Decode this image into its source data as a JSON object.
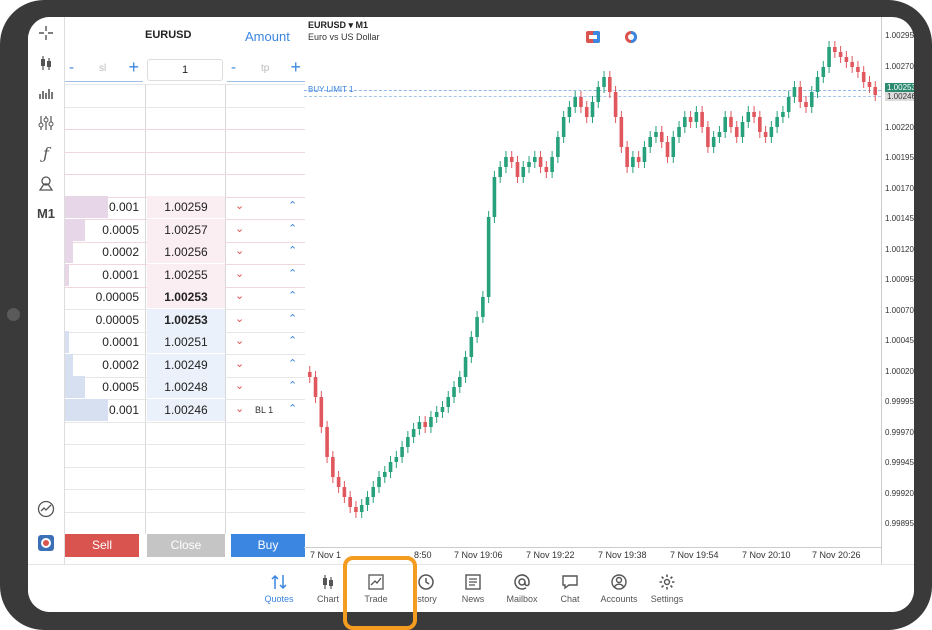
{
  "dom": {
    "symbol": "EURUSD",
    "amount_label": "Amount",
    "sl_placeholder": "sl",
    "tp_placeholder": "tp",
    "volume": "1",
    "minus": "-",
    "plus": "+",
    "rows": [
      {
        "vol": "0.001",
        "price": "1.00259",
        "side": "ask",
        "bar": 0.55,
        "best": false
      },
      {
        "vol": "0.0005",
        "price": "1.00257",
        "side": "ask",
        "bar": 0.25,
        "best": false
      },
      {
        "vol": "0.0002",
        "price": "1.00256",
        "side": "ask",
        "bar": 0.1,
        "best": false
      },
      {
        "vol": "0.0001",
        "price": "1.00255",
        "side": "ask",
        "bar": 0.05,
        "best": false
      },
      {
        "vol": "0.00005",
        "price": "1.00253",
        "side": "ask",
        "bar": 0.0,
        "best": true
      },
      {
        "vol": "0.00005",
        "price": "1.00253",
        "side": "bid",
        "bar": 0.0,
        "best": true
      },
      {
        "vol": "0.0001",
        "price": "1.00251",
        "side": "bid",
        "bar": 0.05,
        "best": false
      },
      {
        "vol": "0.0002",
        "price": "1.00249",
        "side": "bid",
        "bar": 0.1,
        "best": false
      },
      {
        "vol": "0.0005",
        "price": "1.00248",
        "side": "bid",
        "bar": 0.25,
        "best": false
      },
      {
        "vol": "0.001",
        "price": "1.00246",
        "side": "bid",
        "bar": 0.55,
        "best": false,
        "order": "BL 1"
      }
    ],
    "sell_label": "Sell",
    "close_label": "Close",
    "buy_label": "Buy"
  },
  "chart": {
    "symbol": "EURUSD",
    "timeframe": "M1",
    "description": "Euro vs US Dollar",
    "order_line_label": "BUY LIMIT 1",
    "current_price_tag": "1.00253",
    "limit_price_tag": "1.00246",
    "y_ticks": [
      "1.00295",
      "1.00270",
      "1.00245",
      "1.00220",
      "1.00195",
      "1.00170",
      "1.00145",
      "1.00120",
      "1.00095",
      "1.00070",
      "1.00045",
      "1.00020",
      "0.99995",
      "0.99970",
      "0.99945",
      "0.99920",
      "0.99895"
    ],
    "x_ticks": [
      "7 Nov 1",
      "8:50",
      "7 Nov 19:06",
      "7 Nov 19:22",
      "7 Nov 19:38",
      "7 Nov 19:54",
      "7 Nov 20:10",
      "7 Nov 20:26"
    ],
    "up_color": "#26a17b",
    "down_color": "#e0575d"
  },
  "nav": [
    {
      "label": "Quotes",
      "icon": "quotes-icon",
      "active": true
    },
    {
      "label": "Chart",
      "icon": "chart-icon",
      "active": false
    },
    {
      "label": "Trade",
      "icon": "trade-icon",
      "active": false
    },
    {
      "label": "istory",
      "icon": "history-icon",
      "active": false
    },
    {
      "label": "News",
      "icon": "news-icon",
      "active": false
    },
    {
      "label": "Mailbox",
      "icon": "mailbox-icon",
      "active": false
    },
    {
      "label": "Chat",
      "icon": "chat-icon",
      "active": false
    },
    {
      "label": "Accounts",
      "icon": "accounts-icon",
      "active": false
    },
    {
      "label": "Settings",
      "icon": "settings-icon",
      "active": false
    }
  ],
  "toolbar": {
    "timeframe": "M1"
  }
}
